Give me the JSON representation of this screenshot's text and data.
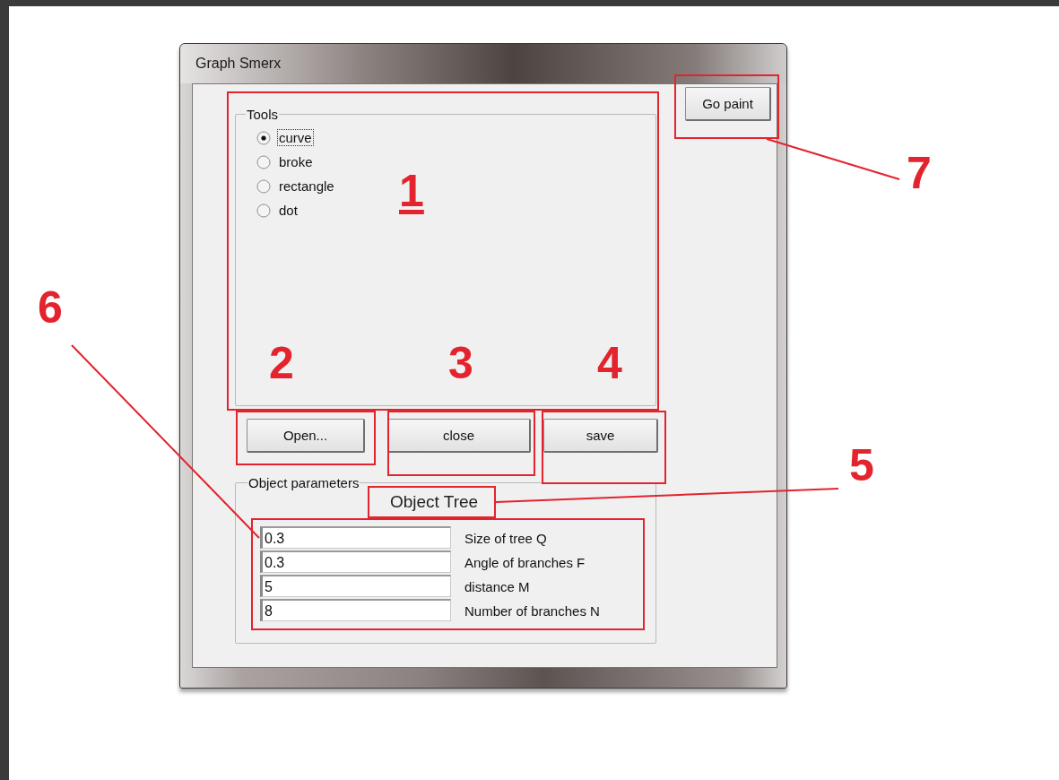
{
  "window": {
    "title": "Graph Smerx"
  },
  "go_button": {
    "label": "Go paint"
  },
  "tools": {
    "title": "Tools",
    "options": [
      {
        "label": "curve",
        "selected": true
      },
      {
        "label": "broke",
        "selected": false
      },
      {
        "label": "rectangle",
        "selected": false
      },
      {
        "label": "dot",
        "selected": false
      }
    ]
  },
  "buttons": [
    {
      "label": "Open..."
    },
    {
      "label": "close"
    },
    {
      "label": "save"
    }
  ],
  "object_parameters": {
    "title": "Object parameters",
    "object": "Object Tree",
    "fields": [
      {
        "value": "0.3",
        "label": "Size of tree Q"
      },
      {
        "value": "0.3",
        "label": "Angle of branches F"
      },
      {
        "value": "5",
        "label": "distance M"
      },
      {
        "value": "8",
        "label": "Number of branches N"
      }
    ]
  },
  "callouts": [
    {
      "number": "1",
      "underlined": true
    },
    {
      "number": "2",
      "underlined": false
    },
    {
      "number": "3",
      "underlined": false
    },
    {
      "number": "4",
      "underlined": false
    },
    {
      "number": "5",
      "underlined": false
    },
    {
      "number": "6",
      "underlined": false
    },
    {
      "number": "7",
      "underlined": false
    }
  ]
}
